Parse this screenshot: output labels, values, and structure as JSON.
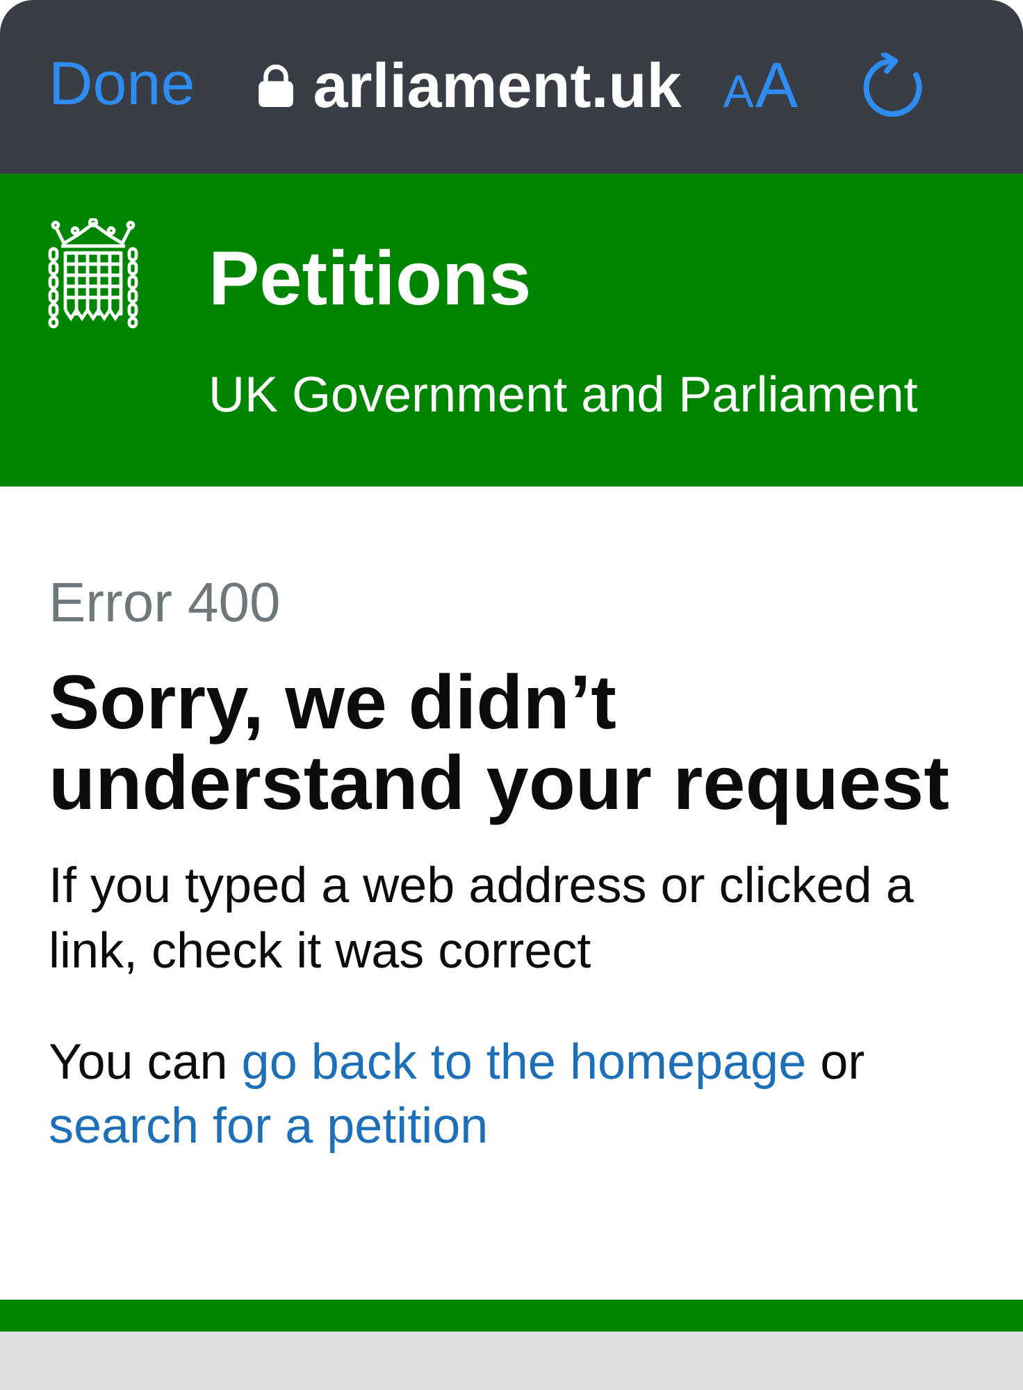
{
  "browser_bar": {
    "done_button": "Done",
    "secure": true,
    "url": "arliament.uk",
    "text_size_button": "AA"
  },
  "header": {
    "title": "Petitions",
    "subtitle": "UK Government and Parliament"
  },
  "error": {
    "code": "Error 400",
    "heading": "Sorry, we didn’t understand your request",
    "message": "If you typed a web address or clicked a link, check it was correct",
    "help": [
      {
        "kind": "text",
        "text": "You can "
      },
      {
        "kind": "link",
        "text": "go back to the homepage"
      },
      {
        "kind": "text",
        "text": " or "
      },
      {
        "kind": "link",
        "text": "search for a petition"
      }
    ]
  }
}
